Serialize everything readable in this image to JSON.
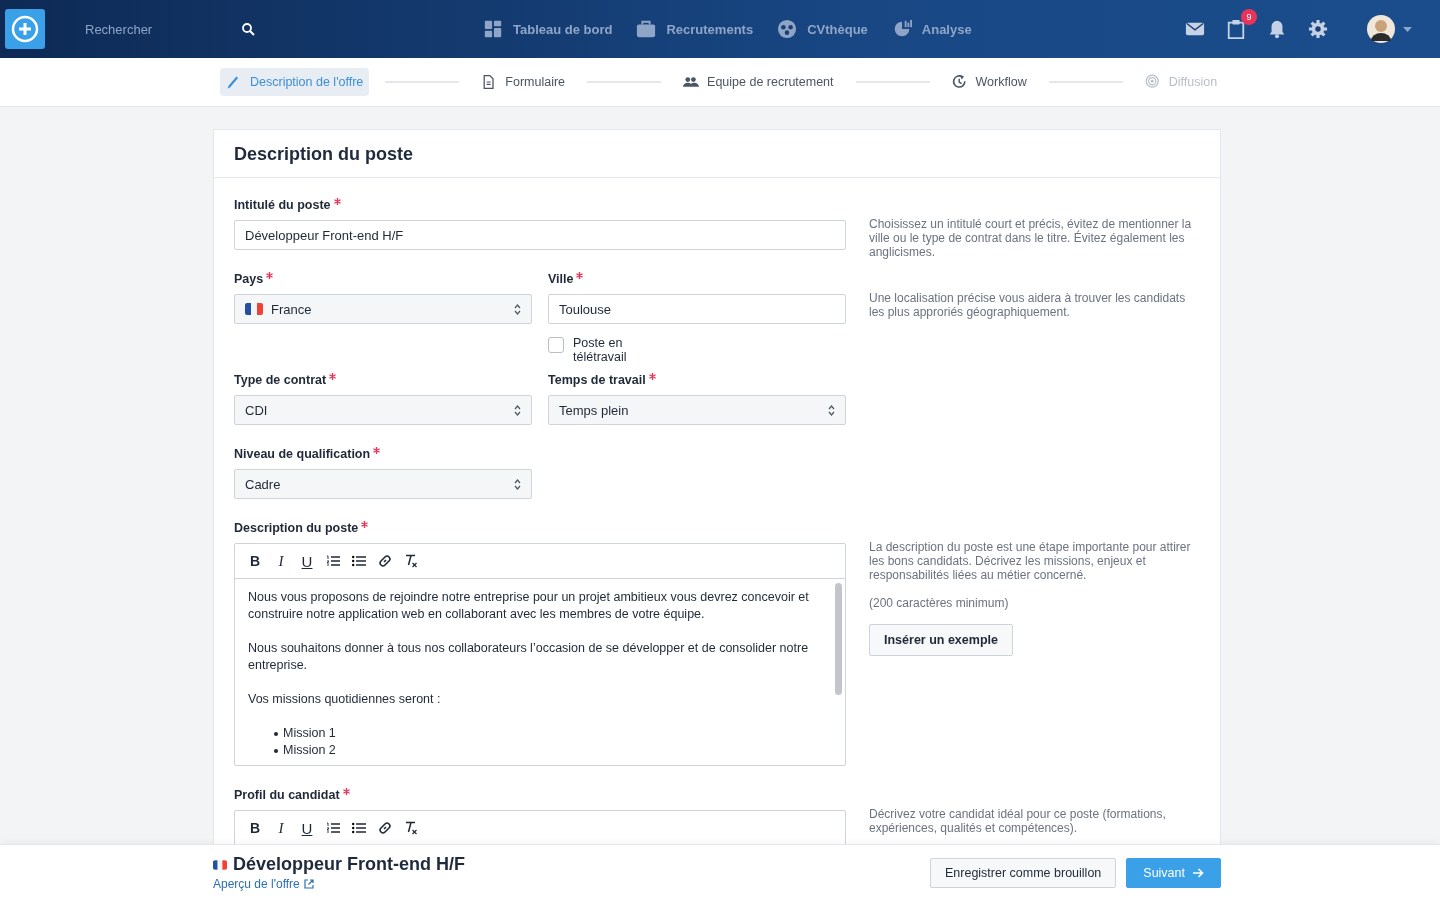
{
  "header": {
    "search": {
      "placeholder": "Rechercher"
    },
    "nav": [
      {
        "label": "Tableau de bord"
      },
      {
        "label": "Recrutements"
      },
      {
        "label": "CVthèque"
      },
      {
        "label": "Analyse"
      }
    ],
    "badge": "9"
  },
  "steps": [
    {
      "label": "Description de l'offre",
      "selected": true,
      "disabled": false
    },
    {
      "label": "Formulaire",
      "selected": false,
      "disabled": false
    },
    {
      "label": "Equipe de recrutement",
      "selected": false,
      "disabled": false
    },
    {
      "label": "Workflow",
      "selected": false,
      "disabled": false
    },
    {
      "label": "Diffusion",
      "selected": false,
      "disabled": true
    }
  ],
  "form": {
    "title": "Description du poste",
    "sections": [
      {
        "fields": [
          {
            "kind": "text",
            "label": "Intitulé du poste",
            "required": true,
            "value": "Développeur Front-end H/F"
          }
        ],
        "hint": {
          "paragraphs": [
            "Choisissez un intitulé court et précis, évitez de mentionner la ville ou le type de contrat dans le titre. Évitez également les anglicismes."
          ]
        }
      },
      {
        "fields": [
          {
            "kind": "country-select",
            "label": "Pays",
            "required": true,
            "value": "France"
          },
          {
            "kind": "text",
            "label": "Ville",
            "required": true,
            "value": "Toulouse",
            "checkbox": {
              "label": "Poste en télétravail",
              "checked": false
            }
          }
        ],
        "hint": {
          "paragraphs": [
            "Une localisation précise vous aidera à trouver les candidats les plus approriés géographiquement."
          ]
        }
      },
      {
        "fields": [
          {
            "kind": "select",
            "label": "Type de contrat",
            "required": true,
            "value": "CDI"
          },
          {
            "kind": "select",
            "label": "Temps de travail",
            "required": true,
            "value": "Temps plein"
          }
        ]
      },
      {
        "fields": [
          {
            "kind": "select",
            "label": "Niveau de qualification",
            "required": true,
            "value": "Cadre"
          }
        ]
      },
      {
        "fields": [
          {
            "kind": "editor",
            "label": "Description du poste",
            "required": true,
            "toolbar": [
              {
                "kind": "bold",
                "label": "B"
              },
              {
                "kind": "italic",
                "label": "I"
              },
              {
                "kind": "underline",
                "label": "U"
              },
              {
                "kind": "ordered-list"
              },
              {
                "kind": "bullet-list"
              },
              {
                "kind": "link"
              },
              {
                "kind": "clear-format"
              }
            ],
            "content": [
              {
                "kind": "paragraph",
                "text": "Nous vous proposons de rejoindre notre entreprise pour un projet ambitieux vous devrez concevoir et construire notre application web en collaborant avec les membres de votre équipe."
              },
              {
                "kind": "paragraph",
                "text": "Nous souhaitons donner à tous nos collaborateurs l’occasion de se développer et de consolider notre entreprise."
              },
              {
                "kind": "paragraph",
                "text": "Vos missions quotidiennes seront :"
              },
              {
                "kind": "list",
                "items": [
                  "Mission 1",
                  "Mission 2"
                ]
              }
            ]
          }
        ],
        "hint": {
          "paragraphs": [
            "La description du poste est une étape importante pour attirer les bons candidats. Décrivez les missions, enjeux et responsabilités liées au métier concerné.",
            "(200 caractères minimum)"
          ],
          "button": "Insérer un exemple"
        }
      },
      {
        "fields": [
          {
            "kind": "editor",
            "label": "Profil du candidat",
            "required": true,
            "toolbar": [
              {
                "kind": "bold",
                "label": "B"
              },
              {
                "kind": "italic",
                "label": "I"
              },
              {
                "kind": "underline",
                "label": "U"
              },
              {
                "kind": "ordered-list"
              },
              {
                "kind": "bullet-list"
              },
              {
                "kind": "link"
              },
              {
                "kind": "clear-format"
              }
            ]
          }
        ],
        "hint": {
          "paragraphs": [
            "Décrivez votre candidat idéal pour ce poste (formations, expériences, qualités et compétences)."
          ]
        }
      }
    ]
  },
  "footer": {
    "title": "Développeur Front-end H/F",
    "link": "Aperçu de l'offre",
    "buttons": [
      {
        "kind": "secondary",
        "label": "Enregistrer comme brouillon"
      },
      {
        "kind": "primary",
        "label": "Suivant"
      }
    ]
  }
}
